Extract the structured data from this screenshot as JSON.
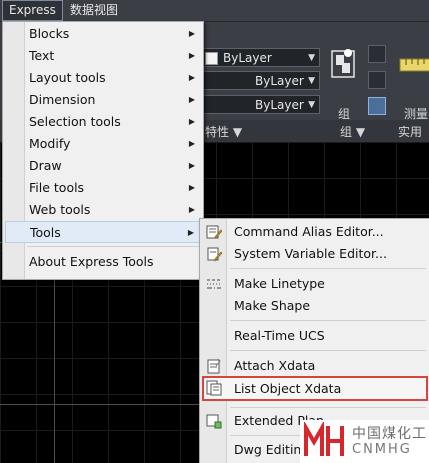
{
  "menubar": {
    "items": [
      "Express",
      "数据视图"
    ]
  },
  "ribbon": {
    "layer_combo_1": "ByLayer",
    "layer_combo_2": "ByLayer",
    "layer_combo_3": "ByLayer",
    "group_label": "组",
    "measure_label": "测量",
    "strip_labels": [
      "特性 ▼",
      "组 ▼",
      "实用工"
    ]
  },
  "express_menu": {
    "items": [
      {
        "label": "Blocks",
        "has_submenu": true
      },
      {
        "label": "Text",
        "has_submenu": true
      },
      {
        "label": "Layout tools",
        "has_submenu": true
      },
      {
        "label": "Dimension",
        "has_submenu": true
      },
      {
        "label": "Selection tools",
        "has_submenu": true
      },
      {
        "label": "Modify",
        "has_submenu": true
      },
      {
        "label": "Draw",
        "has_submenu": true
      },
      {
        "label": "File tools",
        "has_submenu": true
      },
      {
        "label": "Web tools",
        "has_submenu": true
      },
      {
        "label": "Tools",
        "has_submenu": true,
        "highlighted": true
      },
      {
        "label": "About Express Tools",
        "has_submenu": false
      }
    ],
    "submenu_arrow": "▶"
  },
  "tools_submenu": {
    "items": [
      {
        "label": "Command Alias Editor...",
        "icon": "alias-editor-icon"
      },
      {
        "label": "System Variable Editor...",
        "icon": "sysvar-editor-icon"
      },
      {
        "label": "Make Linetype",
        "icon": "linetype-icon"
      },
      {
        "label": "Make Shape",
        "icon": ""
      },
      {
        "label": "Real-Time UCS",
        "icon": ""
      },
      {
        "label": "Attach Xdata",
        "icon": "attach-xdata-icon"
      },
      {
        "label": "List Object Xdata",
        "icon": "list-xdata-icon",
        "outlined": true
      },
      {
        "label": "Extended Plan",
        "icon": "extended-plan-icon"
      },
      {
        "label": "Dwg Editin",
        "icon": ""
      }
    ],
    "outline_color": "#d6453f"
  },
  "watermark": {
    "chinese": "中国煤化工",
    "latin": "CNMHG"
  }
}
